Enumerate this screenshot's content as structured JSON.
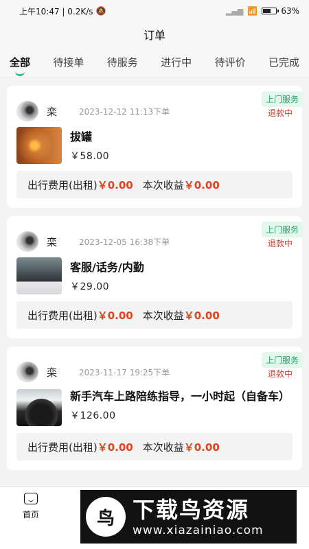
{
  "status_bar": {
    "time_speed": "上午10:47 | 0.2K/s",
    "battery": "63%",
    "battery_level": 0.63
  },
  "header": {
    "title": "订单"
  },
  "tabs": [
    {
      "label": "全部",
      "active": true
    },
    {
      "label": "待接单"
    },
    {
      "label": "待服务"
    },
    {
      "label": "进行中"
    },
    {
      "label": "待评价"
    },
    {
      "label": "已完成"
    }
  ],
  "orders": [
    {
      "user": "栾",
      "time": "2023-12-12 11:13下单",
      "service_tag": "上门服务",
      "status": "退款中",
      "item_name": "拔罐",
      "price": "￥58.00",
      "fee_label": "出行费用(出租)",
      "fee_value": "￥0.00",
      "income_label": "本次收益",
      "income_value": "￥0.00"
    },
    {
      "user": "栾",
      "time": "2023-12-05 16:38下单",
      "service_tag": "上门服务",
      "status": "退款中",
      "item_name": "客服/话务/内勤",
      "price": "￥29.00",
      "fee_label": "出行费用(出租)",
      "fee_value": "￥0.00",
      "income_label": "本次收益",
      "income_value": "￥0.00"
    },
    {
      "user": "栾",
      "time": "2023-11-17 19:25下单",
      "service_tag": "上门服务",
      "status": "退款中",
      "item_name": "新手汽车上路陪练指导，一小时起（自备车）",
      "price": "￥126.00",
      "fee_label": "出行费用(出租)",
      "fee_value": "￥0.00",
      "income_label": "本次收益",
      "income_value": "￥0.00"
    }
  ],
  "bottom_nav": {
    "home_label": "首页"
  },
  "watermark": {
    "logo_char": "鸟",
    "title": "下载鸟资源",
    "url": "www.xiazainiao.com"
  },
  "colors": {
    "accent": "#27c087",
    "price_red": "#e0441f",
    "status_red": "#d23b2f"
  }
}
